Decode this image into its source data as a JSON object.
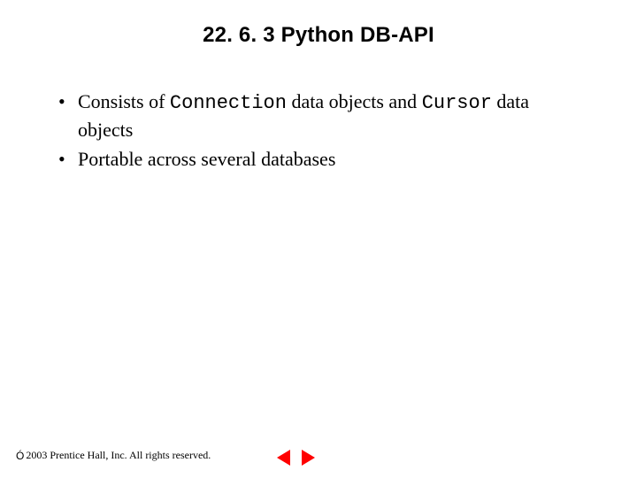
{
  "title": "22. 6. 3 Python DB-API",
  "bullets": [
    {
      "tokens": [
        {
          "t": "Consists of ",
          "cls": "tok-serif"
        },
        {
          "t": "Connection",
          "cls": "tok-mono"
        },
        {
          "t": " data objects and ",
          "cls": "tok-serif"
        },
        {
          "t": "Cursor",
          "cls": "tok-mono"
        },
        {
          "t": " data objects",
          "cls": "tok-serif"
        }
      ]
    },
    {
      "tokens": [
        {
          "t": "Portable across several databases",
          "cls": "tok-serif"
        }
      ]
    }
  ],
  "footer": {
    "symbol": "Ó",
    "text": " 2003 Prentice Hall, Inc.  All rights reserved."
  },
  "nav": {
    "prev": "previous slide",
    "next": "next slide"
  }
}
